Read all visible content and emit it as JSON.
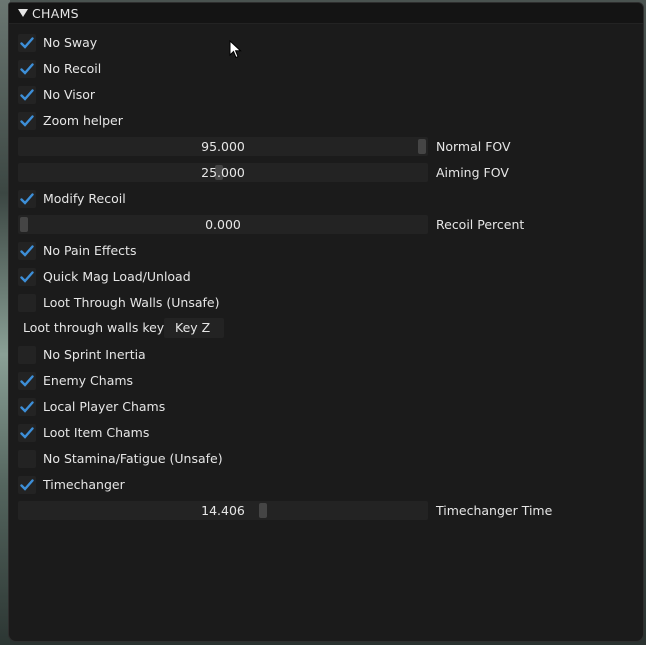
{
  "panel": {
    "title": "CHAMS"
  },
  "options": [
    {
      "label": "No Sway",
      "checked": true
    },
    {
      "label": "No Recoil",
      "checked": true
    },
    {
      "label": "No Visor",
      "checked": true
    },
    {
      "label": "Zoom helper",
      "checked": true
    },
    {
      "label": "Modify Recoil",
      "checked": true
    },
    {
      "label": "No Pain Effects",
      "checked": true
    },
    {
      "label": "Quick Mag Load/Unload",
      "checked": true
    },
    {
      "label": "Loot Through Walls (Unsafe)",
      "checked": false
    },
    {
      "label": "No Sprint Inertia",
      "checked": false
    },
    {
      "label": "Enemy Chams",
      "checked": true
    },
    {
      "label": "Local Player Chams",
      "checked": true
    },
    {
      "label": "Loot Item Chams",
      "checked": true
    },
    {
      "label": "No Stamina/Fatigue (Unsafe)",
      "checked": false
    },
    {
      "label": "Timechanger",
      "checked": true
    }
  ],
  "sliders": [
    {
      "label": "Normal FOV",
      "value": "95.000",
      "fraction": 1.0
    },
    {
      "label": "Aiming FOV",
      "value": "25.000",
      "fraction": 0.49
    },
    {
      "label": "Recoil Percent",
      "value": "0.000",
      "fraction": 0.0
    },
    {
      "label": "Timechanger Time",
      "value": "14.406",
      "fraction": 0.6
    }
  ],
  "keybind": {
    "label": "Loot through walls key",
    "value": "Key Z"
  },
  "colors": {
    "check": "#3d8fd8",
    "frame": "#232323",
    "grab": "#454545",
    "window": "#1b1b1b"
  }
}
